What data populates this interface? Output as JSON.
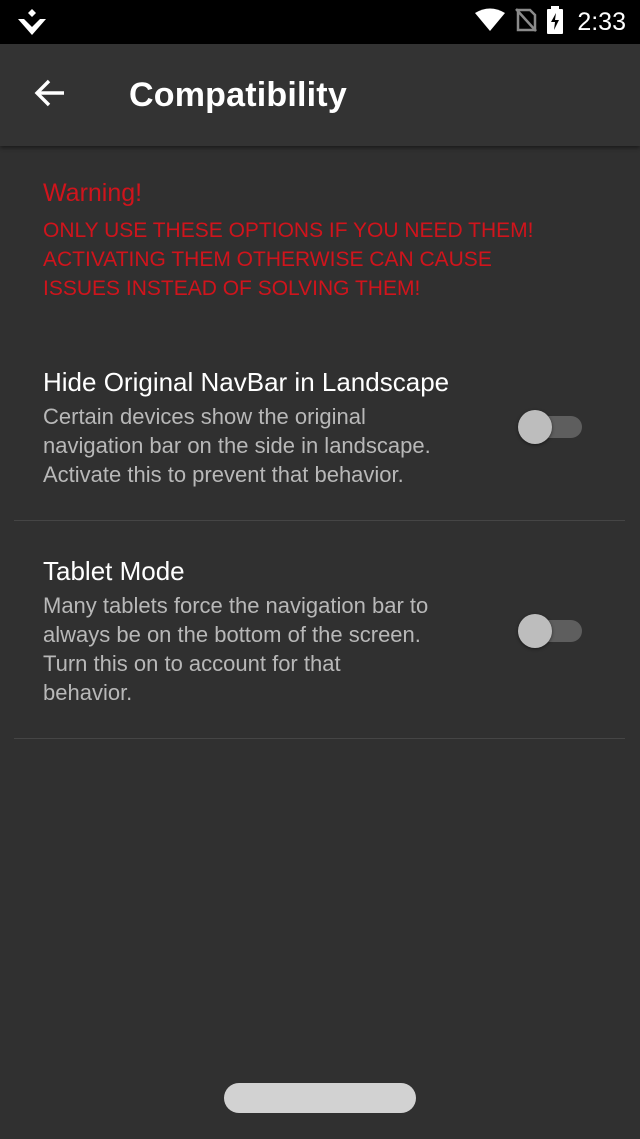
{
  "status_bar": {
    "time": "2:33",
    "icons": [
      "app-notification-icon",
      "wifi-icon",
      "no-sim-icon",
      "battery-charging-icon"
    ]
  },
  "app_bar": {
    "title": "Compatibility",
    "back_icon": "arrow-back-icon"
  },
  "warning": {
    "title": "Warning!",
    "lines": [
      "ONLY USE THESE OPTIONS IF YOU NEED THEM!",
      "ACTIVATING THEM OTHERWISE CAN CAUSE",
      "ISSUES INSTEAD OF SOLVING THEM!"
    ],
    "color": "#d0141c"
  },
  "settings": [
    {
      "title": "Hide Original NavBar in Landscape",
      "description_lines": [
        "Certain devices show the original",
        "navigation bar on the side in landscape.",
        "Activate this to prevent that behavior."
      ],
      "enabled": false
    },
    {
      "title": "Tablet Mode",
      "description_lines": [
        "Many tablets force the navigation bar to",
        "always be on the bottom of the screen.",
        "Turn this on to account for that",
        "behavior."
      ],
      "enabled": false
    }
  ],
  "colors": {
    "background": "#303030",
    "app_bar": "#333333",
    "status_bar": "#000000",
    "switch_thumb_off": "#bdbdbd",
    "switch_track_off": "#5e5e5e"
  }
}
